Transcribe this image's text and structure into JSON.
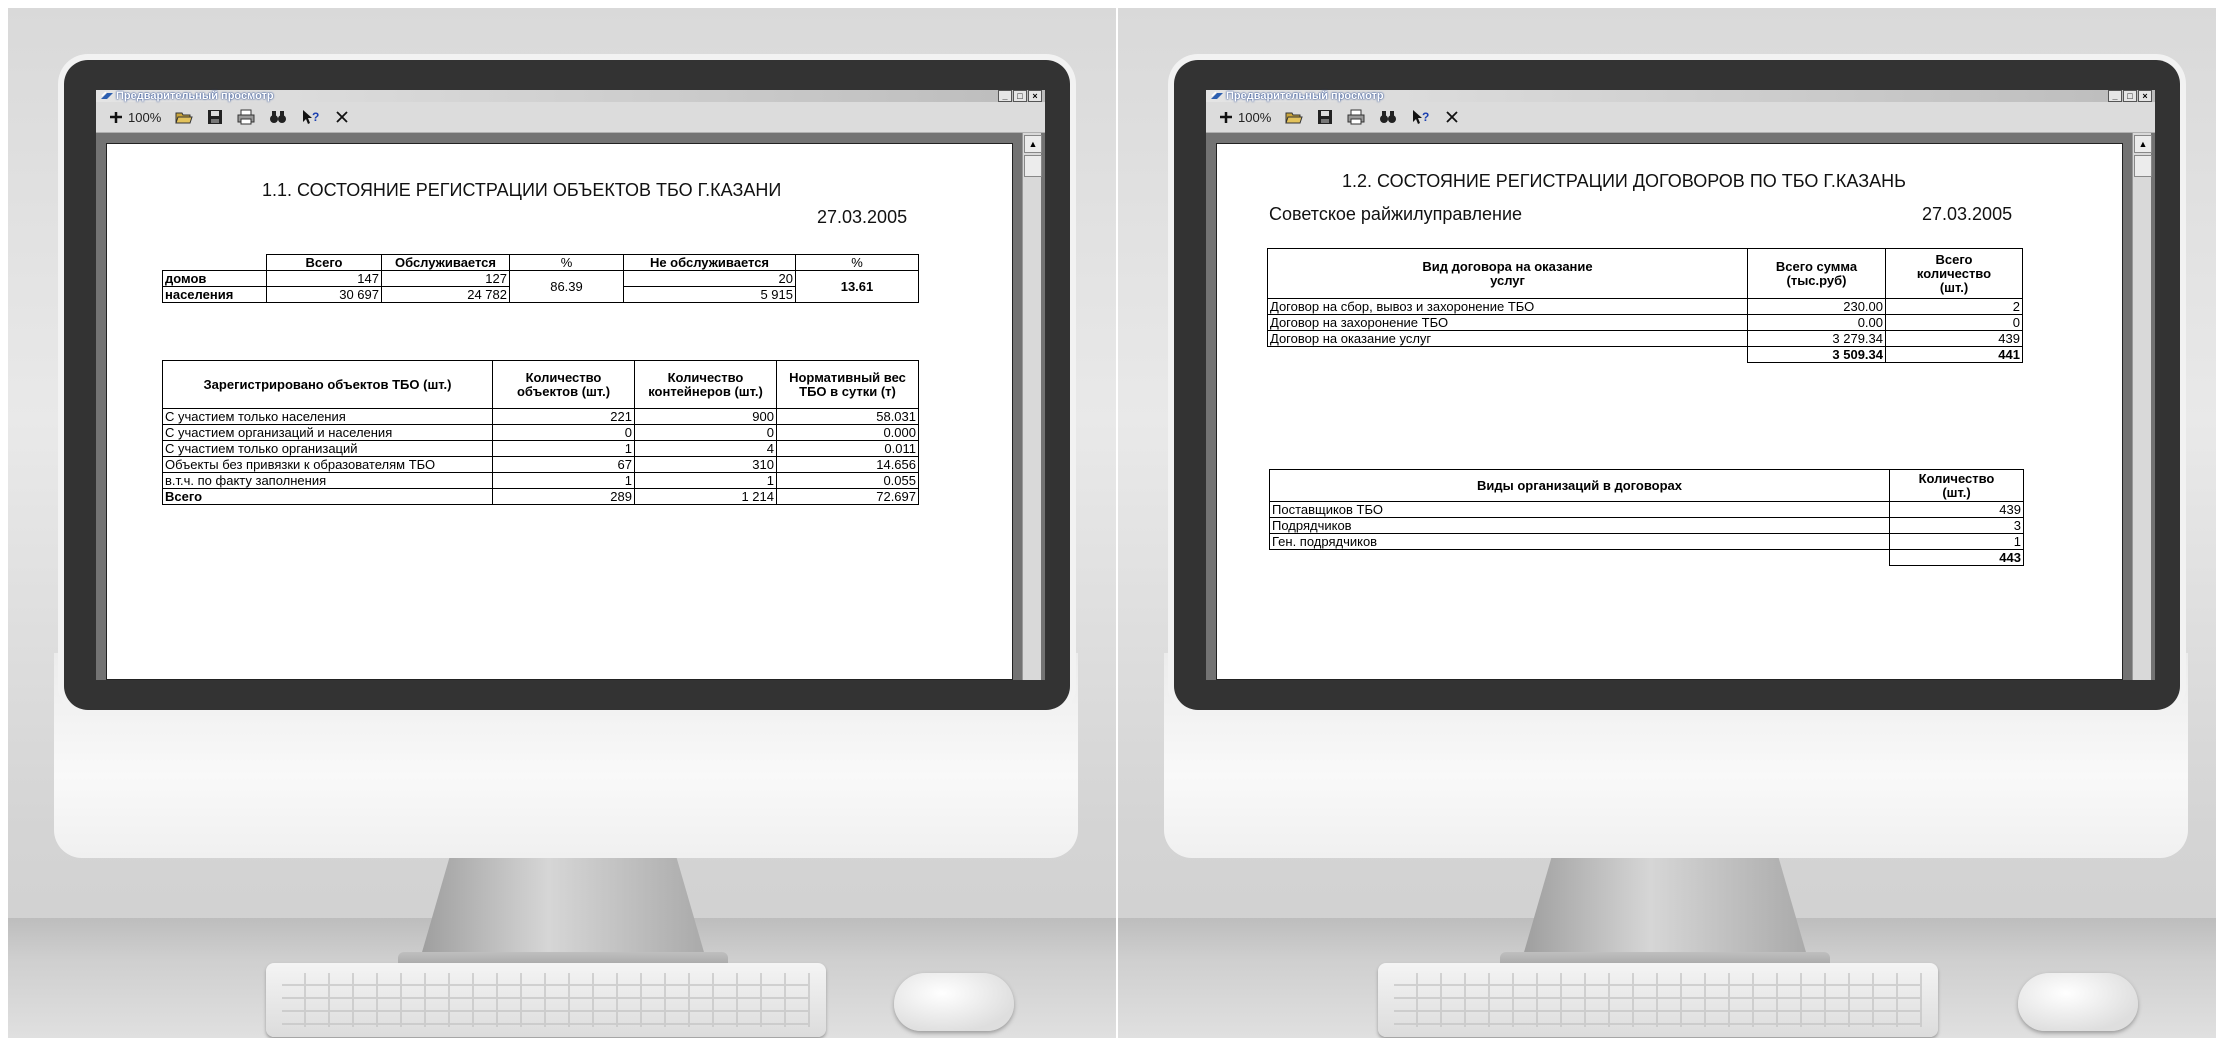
{
  "window": {
    "title": "Предварительный просмотр",
    "buttons": [
      "_",
      "□",
      "×"
    ]
  },
  "toolbar": {
    "zoom": "100%",
    "tools": [
      "zoom-tool-icon",
      "open-folder-icon",
      "save-icon",
      "print-icon",
      "find-binoculars-icon",
      "context-help-icon",
      "close-icon"
    ]
  },
  "left_report": {
    "title": "1.1. СОСТОЯНИЕ РЕГИСТРАЦИИ ОБЪЕКТОВ ТБО Г.КАЗАНИ",
    "date": "27.03.2005",
    "summary": {
      "headers": [
        "",
        "Всего",
        "Обслуживается",
        "%",
        "Не обслуживается",
        "%"
      ],
      "rows": [
        {
          "label": "домов",
          "total": "147",
          "served": "127",
          "not_served": "20"
        },
        {
          "label": "населения",
          "total": "30 697",
          "served": "24 782",
          "not_served": "5 915"
        }
      ],
      "served_pct": "86.39",
      "not_served_pct": "13.61"
    },
    "objects": {
      "headers": [
        "Зарегистрировано объектов ТБО (шт.)",
        "Количество объектов (шт.)",
        "Количество контейнеров (шт.)",
        "Нормативный вес ТБО в сутки (т)"
      ],
      "rows": [
        {
          "label": "С участием только населения",
          "objects": "221",
          "containers": "900",
          "weight": "58.031"
        },
        {
          "label": "С участием организаций и населения",
          "objects": "0",
          "containers": "0",
          "weight": "0.000"
        },
        {
          "label": "С участием только организаций",
          "objects": "1",
          "containers": "4",
          "weight": "0.011"
        },
        {
          "label": "Объекты без привязки к образователям ТБО",
          "objects": "67",
          "containers": "310",
          "weight": "14.656"
        },
        {
          "label": "в.т.ч. по факту заполнения",
          "objects": "1",
          "containers": "1",
          "weight": "0.055"
        },
        {
          "label": "Всего",
          "objects": "289",
          "containers": "1 214",
          "weight": "72.697"
        }
      ]
    }
  },
  "right_report": {
    "title": "1.2. СОСТОЯНИЕ РЕГИСТРАЦИИ ДОГОВОРОВ ПО ТБО  Г.КАЗАНЬ",
    "org": "Советское райжилуправление",
    "date": "27.03.2005",
    "contracts": {
      "headers": [
        "Вид договора на оказание услуг",
        "Всего сумма (тыс.руб)",
        "Всего количество (шт.)"
      ],
      "rows": [
        {
          "label": "Договор на сбор, вывоз и захоронение ТБО",
          "sum": "230.00",
          "count": "2"
        },
        {
          "label": "Договор на захоронение ТБО",
          "sum": "0.00",
          "count": "0"
        },
        {
          "label": "Договор на оказание услуг",
          "sum": "3 279.34",
          "count": "439"
        }
      ],
      "total_sum": "3 509.34",
      "total_count": "441"
    },
    "orgs": {
      "headers": [
        "Виды организаций в договорах",
        "Количество (шт.)"
      ],
      "rows": [
        {
          "label": "Поставщиков ТБО",
          "count": "439"
        },
        {
          "label": "Подрядчиков",
          "count": "3"
        },
        {
          "label": "Ген. подрядчиков",
          "count": "1"
        }
      ],
      "total": "443"
    }
  }
}
